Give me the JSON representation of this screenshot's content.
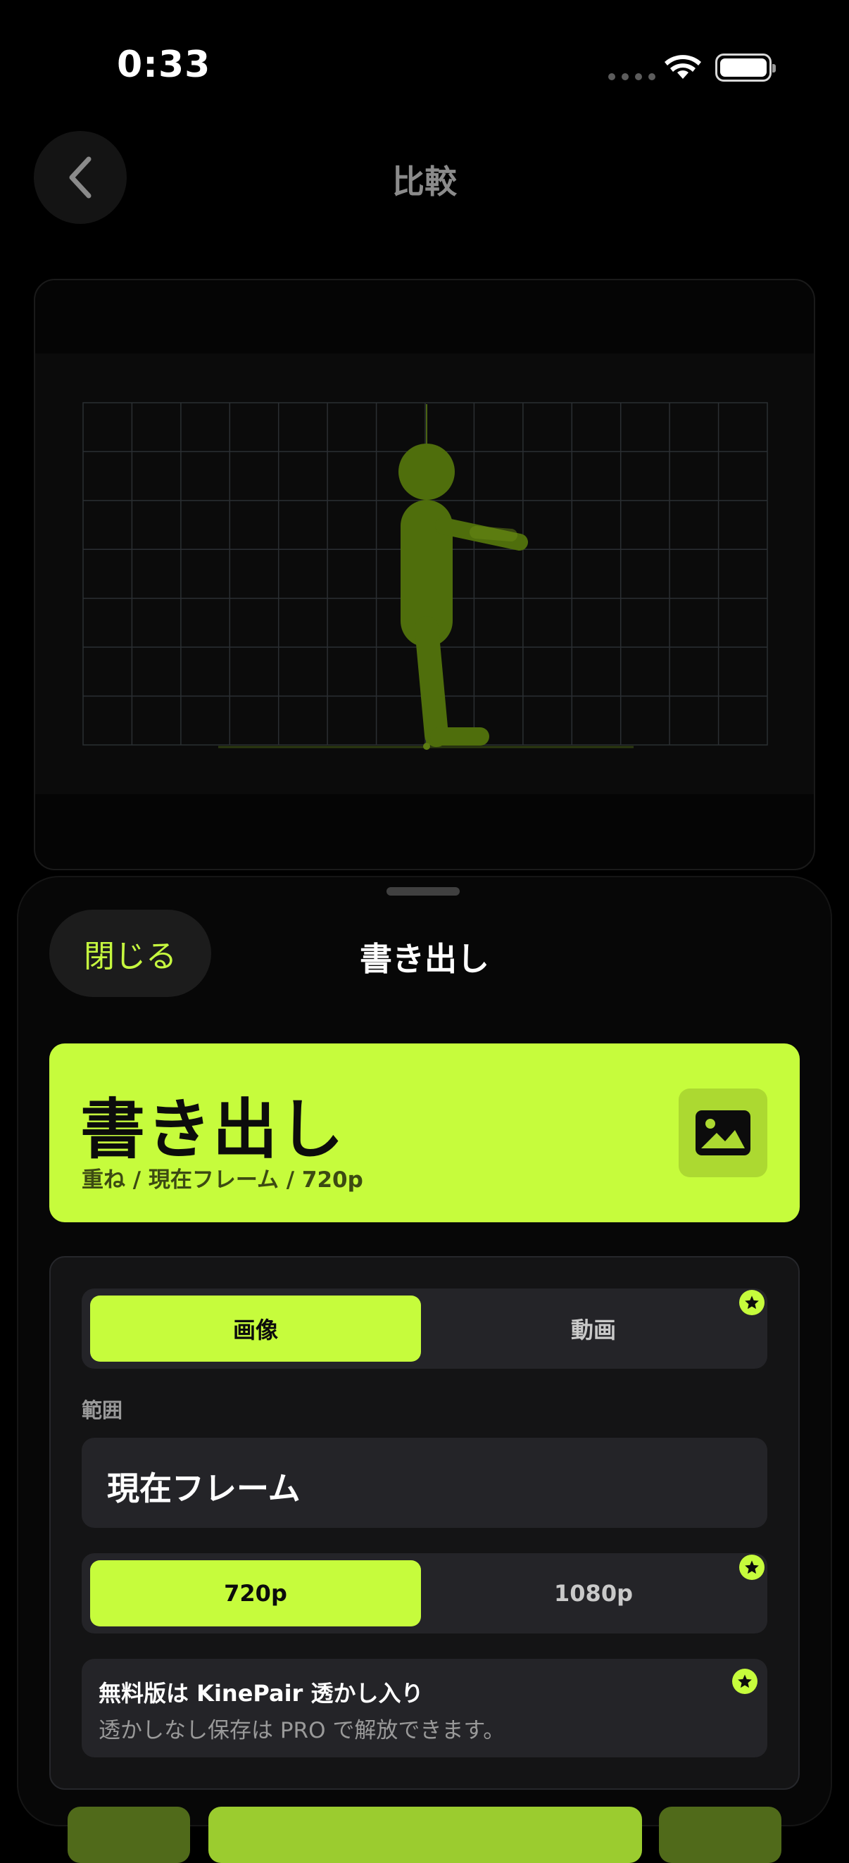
{
  "status_bar": {
    "time": "0:33"
  },
  "nav": {
    "title": "比較",
    "back_icon": "chevron-left-icon"
  },
  "sheet": {
    "close_label": "閉じる",
    "title": "書き出し",
    "hero": {
      "title": "書き出し",
      "subtitle": "重ね / 現在フレーム / 720p",
      "icon": "image-icon"
    },
    "format": {
      "options": [
        "画像",
        "動画"
      ],
      "selected": "画像",
      "pro_badge": "star-icon"
    },
    "range": {
      "label": "範囲",
      "value": "現在フレーム"
    },
    "resolution": {
      "options": [
        "720p",
        "1080p"
      ],
      "selected": "720p",
      "pro_badge": "star-icon"
    },
    "watermark_notice": {
      "title": "無料版は KinePair 透かし入り",
      "description": "透かしなし保存は PRO で解放できます。"
    }
  },
  "colors": {
    "accent": "#c6fc3c",
    "figure": "#5a7a0e",
    "background": "#000000"
  }
}
